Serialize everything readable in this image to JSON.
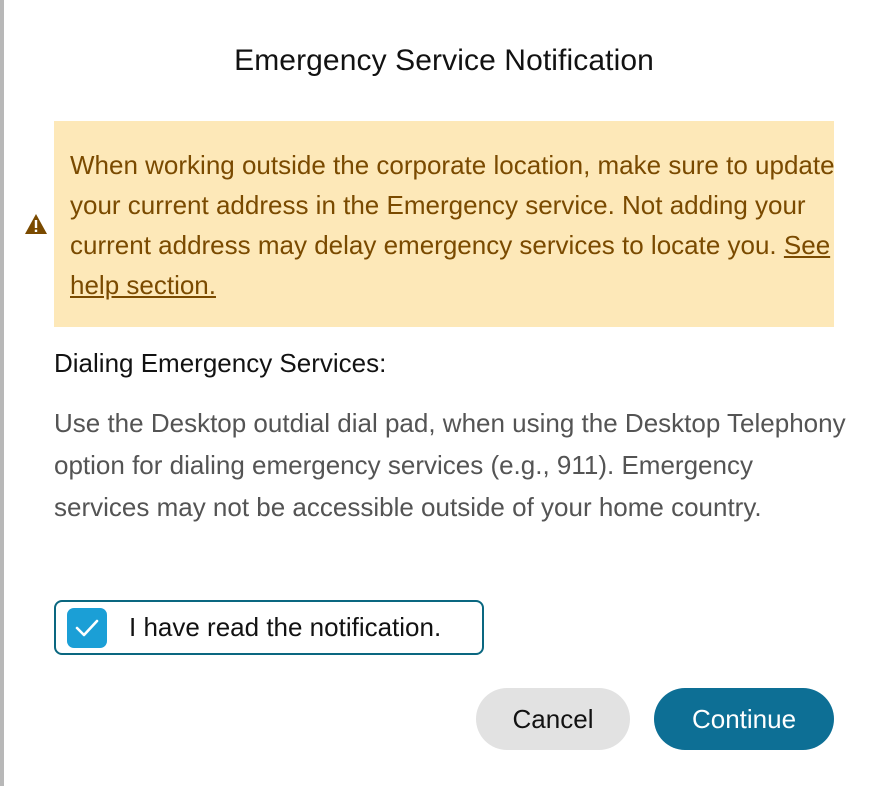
{
  "dialog": {
    "title": "Emergency Service Notification",
    "warning": {
      "icon": "warning-triangle-icon",
      "text": "When working outside the corporate location, make sure to update your current address in the Emergency service. Not adding your current address may delay emergency services to locate you. ",
      "link_text": "See help section."
    },
    "section": {
      "heading": "Dialing Emergency Services:",
      "body": "Use the Desktop outdial dial pad, when using the Desktop Telephony option for dialing emergency services (e.g., 911). Emergency services may not be accessible outside of your home country."
    },
    "acknowledge": {
      "label": "I have read the notification.",
      "checked": true
    },
    "buttons": {
      "cancel_label": "Cancel",
      "continue_label": "Continue"
    }
  },
  "colors": {
    "warning_bg": "#fde8b8",
    "warning_text": "#7a4a00",
    "primary": "#0d6f95",
    "checkbox": "#1b9fd6"
  }
}
